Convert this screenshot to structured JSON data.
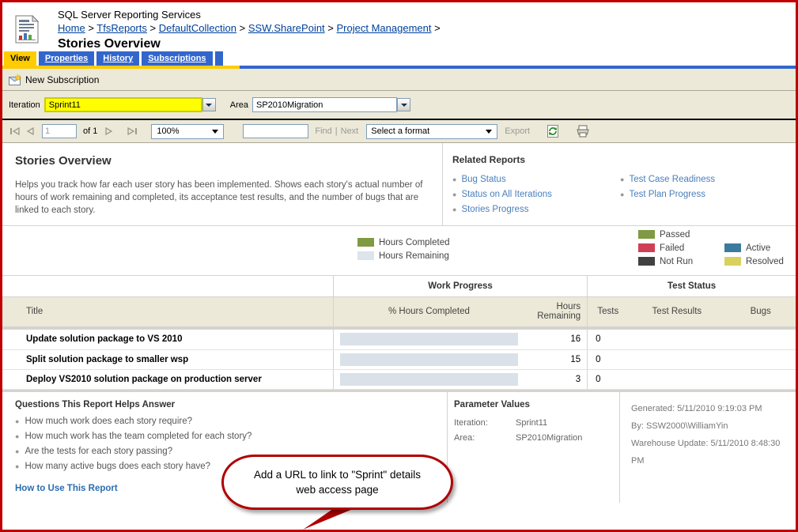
{
  "header": {
    "app_title": "SQL Server Reporting Services",
    "page_title": "Stories Overview",
    "breadcrumb": [
      {
        "label": "Home",
        "sep": ">"
      },
      {
        "label": "TfsReports",
        "sep": ">"
      },
      {
        "label": "DefaultCollection",
        "sep": ">"
      },
      {
        "label": "SSW.SharePoint",
        "sep": ">"
      },
      {
        "label": "Project Management",
        "sep": ">"
      }
    ]
  },
  "tabs": [
    {
      "label": "View",
      "active": true
    },
    {
      "label": "Properties",
      "active": false
    },
    {
      "label": "History",
      "active": false
    },
    {
      "label": "Subscriptions",
      "active": false
    }
  ],
  "subscription_bar": {
    "label": "New Subscription"
  },
  "parameters": {
    "iteration_label": "Iteration",
    "iteration_value": "Sprint11",
    "area_label": "Area",
    "area_value": "SP2010Migration"
  },
  "toolbar": {
    "page_value": "1",
    "page_placeholder": "1",
    "of_label": "of 1",
    "zoom_value": "100%",
    "find_value": "",
    "find_label": "Find",
    "find_sep": "|",
    "next_label": "Next",
    "format_value": "Select a format",
    "export_label": "Export"
  },
  "report": {
    "title": "Stories Overview",
    "description": "Helps you track how far each user story has been implemented. Shows each story's actual number of hours of work remaining and completed, its acceptance test results, and the number of bugs that are linked to each story.",
    "related_title": "Related Reports",
    "related_left": [
      "Bug Status",
      "Status on All Iterations",
      "Stories Progress"
    ],
    "related_right": [
      "Test Case Readiness",
      "Test Plan Progress"
    ]
  },
  "legend": {
    "work": [
      {
        "label": "Hours Completed",
        "color": "#7f9a43"
      },
      {
        "label": "Hours Remaining",
        "color": "#dde4ea"
      }
    ],
    "test_left": [
      {
        "label": "Passed",
        "color": "#7f9a43"
      },
      {
        "label": "Failed",
        "color": "#cf4055"
      },
      {
        "label": "Not Run",
        "color": "#414141"
      }
    ],
    "test_right": [
      {
        "label": "Active",
        "color": "#3d7b9e"
      },
      {
        "label": "Resolved",
        "color": "#d9d15e"
      }
    ]
  },
  "table": {
    "group_headers": [
      "Work Progress",
      "Test Status"
    ],
    "columns": [
      "Title",
      "% Hours Completed",
      "Hours Remaining",
      "Tests",
      "Test Results",
      "Bugs"
    ],
    "rows": [
      {
        "title": "Update solution package to VS 2010",
        "percent_completed": 0,
        "hours_remaining": "16",
        "tests": "0",
        "test_results": "",
        "bugs": ""
      },
      {
        "title": "Split solution package to smaller wsp",
        "percent_completed": 0,
        "hours_remaining": "15",
        "tests": "0",
        "test_results": "",
        "bugs": ""
      },
      {
        "title": "Deploy VS2010 solution package on production server",
        "percent_completed": 0,
        "hours_remaining": "3",
        "tests": "0",
        "test_results": "",
        "bugs": ""
      }
    ]
  },
  "questions": {
    "title": "Questions This Report Helps Answer",
    "items": [
      "How much work does each story require?",
      "How much work has the team completed for each story?",
      "Are the tests for each story passing?",
      "How many active bugs does each story have?"
    ],
    "link": "How to Use This Report"
  },
  "parameter_values": {
    "title": "Parameter Values",
    "rows": [
      {
        "key": "Iteration:",
        "value": "Sprint11"
      },
      {
        "key": "Area:",
        "value": "SP2010Migration"
      }
    ]
  },
  "metadata": {
    "generated": "Generated: 5/11/2010 9:19:03 PM",
    "by": "By: SSW2000\\WilliamYin",
    "warehouse": "Warehouse Update: 5/11/2010 8:48:30 PM"
  },
  "callout": {
    "line1": "Add a URL to link to \"Sprint\" details",
    "line2": "web access page"
  },
  "chart_data": {
    "type": "bar",
    "title": "Work Progress - % Hours Completed",
    "categories": [
      "Update solution package to VS 2010",
      "Split solution package to smaller wsp",
      "Deploy VS2010 solution package on production server"
    ],
    "series": [
      {
        "name": "Hours Completed",
        "values": [
          0,
          0,
          0
        ],
        "color": "#7f9a43"
      },
      {
        "name": "Hours Remaining",
        "values": [
          100,
          100,
          100
        ],
        "color": "#dde4ea"
      }
    ],
    "hours_remaining": [
      16,
      15,
      3
    ],
    "xlabel": "% Hours Completed",
    "ylabel": "",
    "ylim": [
      0,
      100
    ],
    "grid": false,
    "legend_position": "top"
  }
}
